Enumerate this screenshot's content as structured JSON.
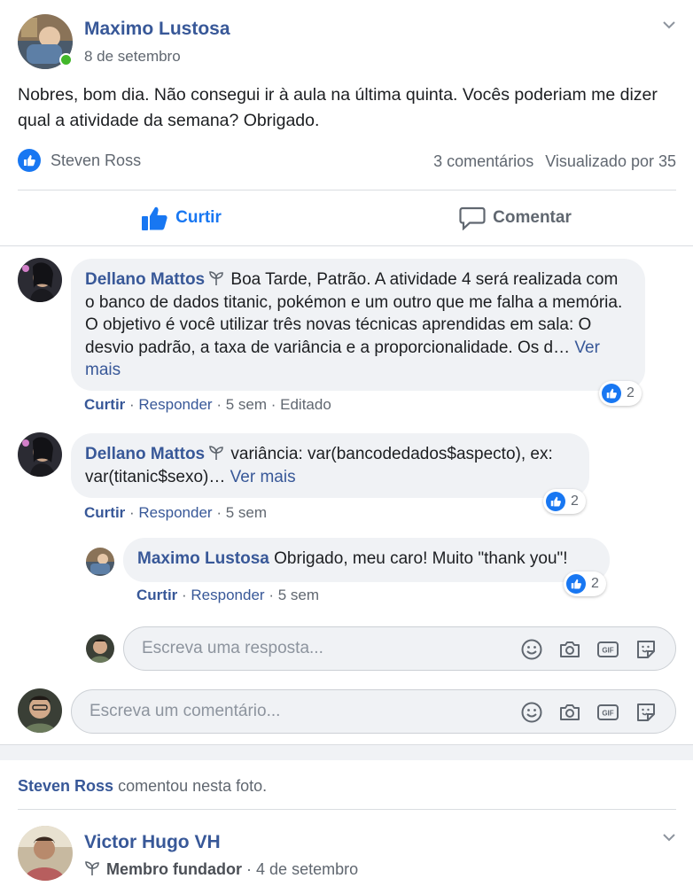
{
  "post": {
    "author": "Maximo Lustosa",
    "date": "8 de setembro",
    "text": "Nobres, bom dia. Não consegui ir à aula na última quinta. Vocês poderiam me dizer qual a atividade da semana? Obrigado.",
    "liker": "Steven Ross",
    "comments_count": "3 comentários",
    "seen_by": "Visualizado por 35"
  },
  "actions": {
    "like": "Curtir",
    "comment": "Comentar"
  },
  "comments": [
    {
      "author": "Dellano Mattos",
      "text": "Boa Tarde, Patrão. A atividade 4 será realizada com o banco de dados titanic, pokémon e um outro que me falha a memória. O objetivo é você utilizar três novas técnicas aprendidas em sala: O desvio padrão, a taxa de variância e a proporcionalidade. Os d…",
      "see_more": "Ver mais",
      "reactions": "2",
      "like": "Curtir",
      "reply": "Responder",
      "time": "5 sem",
      "edited": "Editado"
    },
    {
      "author": "Dellano Mattos",
      "text": "variância: var(bancodedados$aspecto), ex: var(titanic$sexo)…",
      "see_more": "Ver mais",
      "reactions": "2",
      "like": "Curtir",
      "reply": "Responder",
      "time": "5 sem"
    }
  ],
  "reply": {
    "author": "Maximo Lustosa",
    "text": "Obrigado, meu caro! Muito \"thank you\"!",
    "reactions": "2",
    "like": "Curtir",
    "reply": "Responder",
    "time": "5 sem"
  },
  "reply_input": {
    "placeholder": "Escreva uma resposta..."
  },
  "comment_input": {
    "placeholder": "Escreva um comentário..."
  },
  "activity": {
    "actor": "Steven Ross",
    "text": "comentou nesta foto."
  },
  "next_post": {
    "author": "Victor Hugo VH",
    "badge": "Membro fundador",
    "date": "4 de setembro"
  },
  "input_icons": [
    "emoji-icon",
    "camera-icon",
    "gif-icon",
    "sticker-icon"
  ],
  "colors": {
    "link": "#385898",
    "brand": "#1877f2",
    "online": "#42b72a",
    "bubble": "#f0f2f5"
  }
}
